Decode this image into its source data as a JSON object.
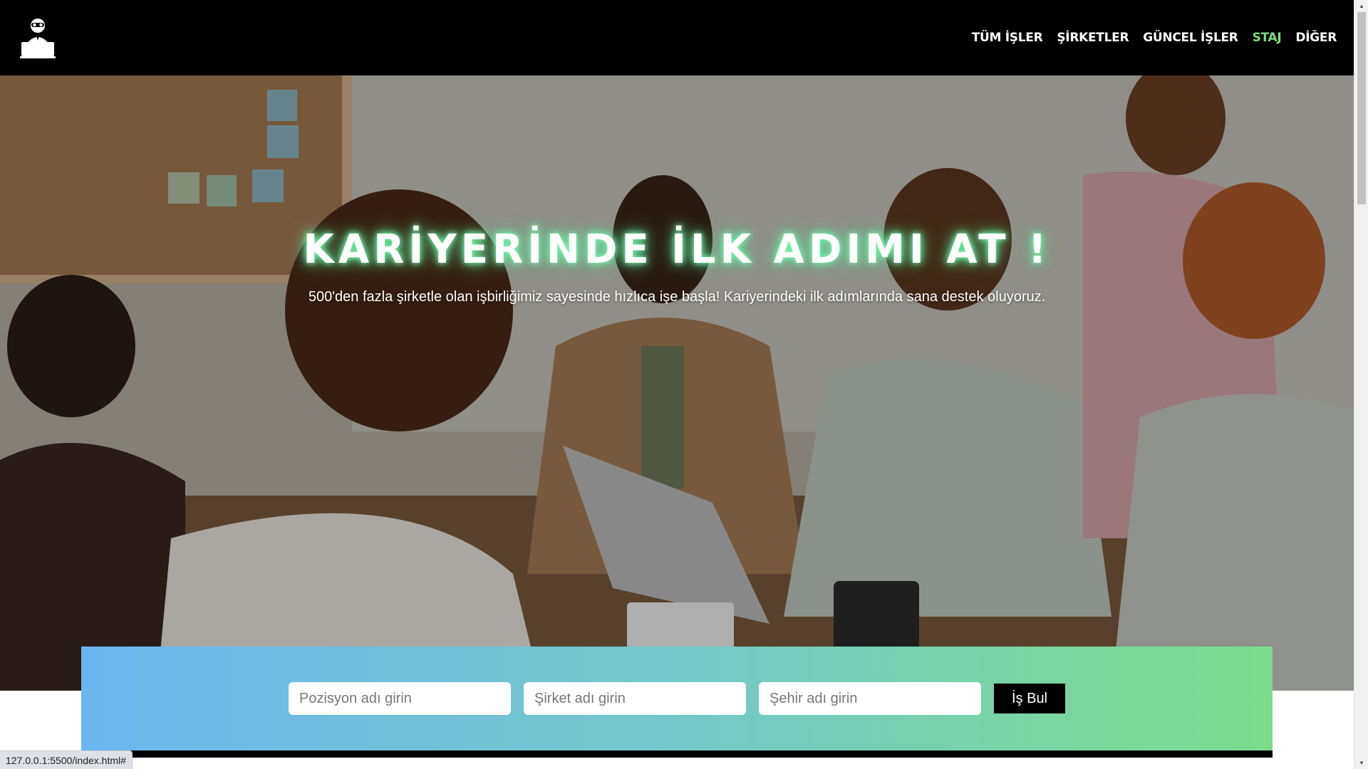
{
  "header": {
    "logo_icon": "hacker-laptop-icon",
    "nav": [
      {
        "label": "TÜM İŞLER",
        "active": false
      },
      {
        "label": "ŞİRKETLER",
        "active": false
      },
      {
        "label": "GÜNCEL İŞLER",
        "active": false
      },
      {
        "label": "STAJ",
        "active": true
      },
      {
        "label": "DİĞER",
        "active": false
      }
    ]
  },
  "hero": {
    "title": "KARİYERİNDE İLK ADIMI AT !",
    "subtitle": "500'den fazla şirketle olan işbirliğimiz sayesinde hızlıca işe başla! Kariyerindeki ilk adımlarında sana destek oluyoruz."
  },
  "search": {
    "position_placeholder": "Pozisyon adı girin",
    "company_placeholder": "Şirket adı girin",
    "city_placeholder": "Şehir adı girin",
    "button_label": "İş Bul"
  },
  "status_bar": {
    "url": "127.0.0.1:5500/index.html#"
  },
  "colors": {
    "header_bg": "#000000",
    "nav_active": "#7ddc83",
    "panel_gradient_start": "#6bb6ef",
    "panel_gradient_end": "#7ddc8c",
    "title_glow": "#5fe39b"
  }
}
